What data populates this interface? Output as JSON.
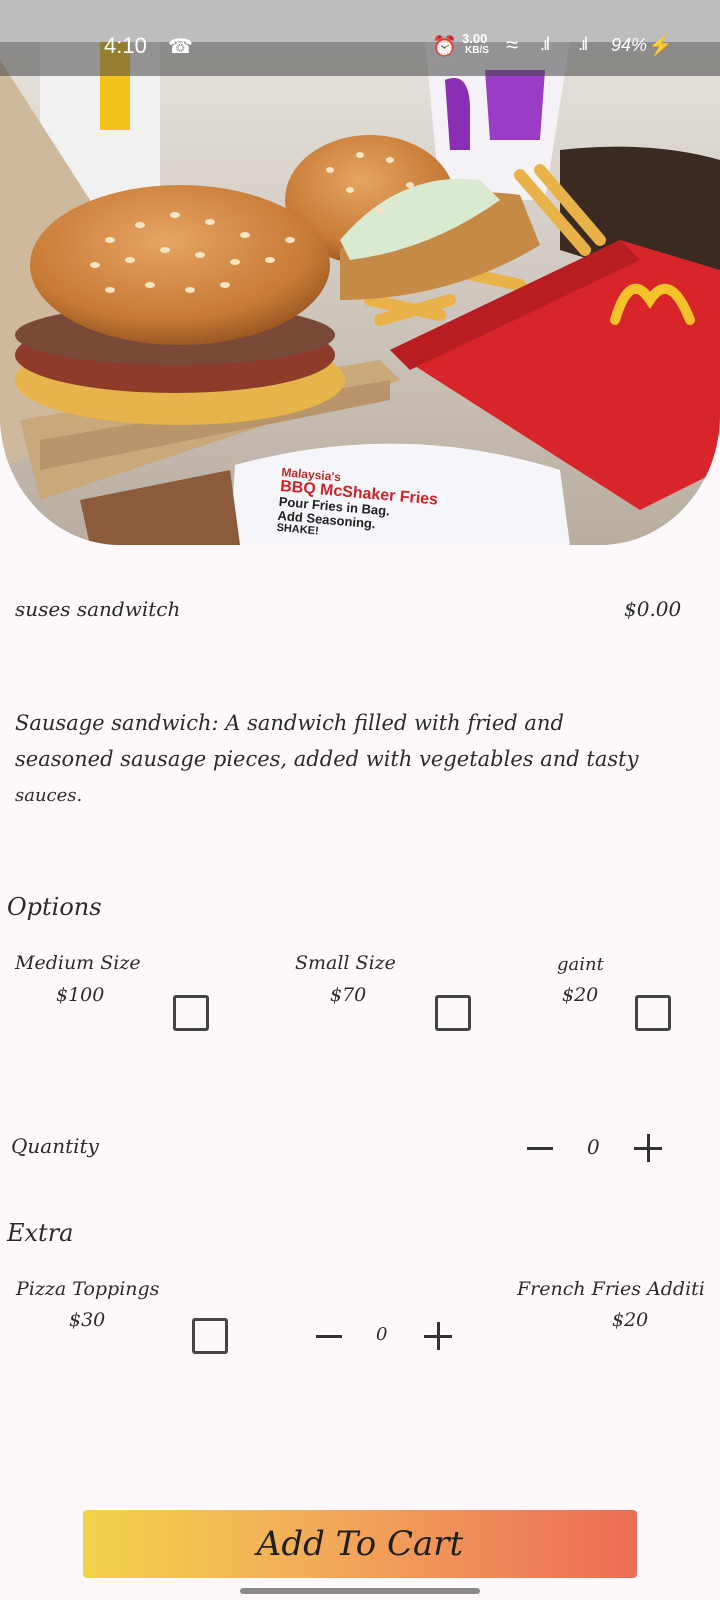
{
  "status_bar": {
    "time": "4:10",
    "net_speed_value": "3.00",
    "net_speed_unit": "KB/S",
    "battery": "94%"
  },
  "hero": {
    "promo_line1": "Malaysia's",
    "promo_line2": "BBQ McShaker Fries",
    "promo_line3": "Pour Fries in Bag.",
    "promo_line4": "Add Seasoning.",
    "promo_line5": "SHAKE!"
  },
  "product": {
    "name": "suses sandwitch",
    "price": "$0.00",
    "description_lines": [
      "Sausage sandwich: A sandwich filled with fried and",
      "seasoned sausage pieces, added with vegetables and tasty",
      "sauces."
    ]
  },
  "options": {
    "heading": "Options",
    "items": [
      {
        "label": "Medium Size",
        "price": "$100",
        "checked": false
      },
      {
        "label": "Small Size",
        "price": "$70",
        "checked": false
      },
      {
        "label": "gaint",
        "price": "$20",
        "checked": false
      }
    ]
  },
  "quantity": {
    "label": "Quantity",
    "value": "0"
  },
  "extra": {
    "heading": "Extra",
    "items": [
      {
        "label": "Pizza Toppings",
        "price": "$30",
        "checked": false,
        "qty": "0"
      },
      {
        "label": "French Fries Additi",
        "price": "$20"
      }
    ]
  },
  "cta": {
    "add_to_cart": "Add To Cart"
  },
  "colors": {
    "cta_gradient_start": "#f3d34a",
    "cta_gradient_end": "#ec6c55",
    "page_bg": "#fdf8fb"
  }
}
